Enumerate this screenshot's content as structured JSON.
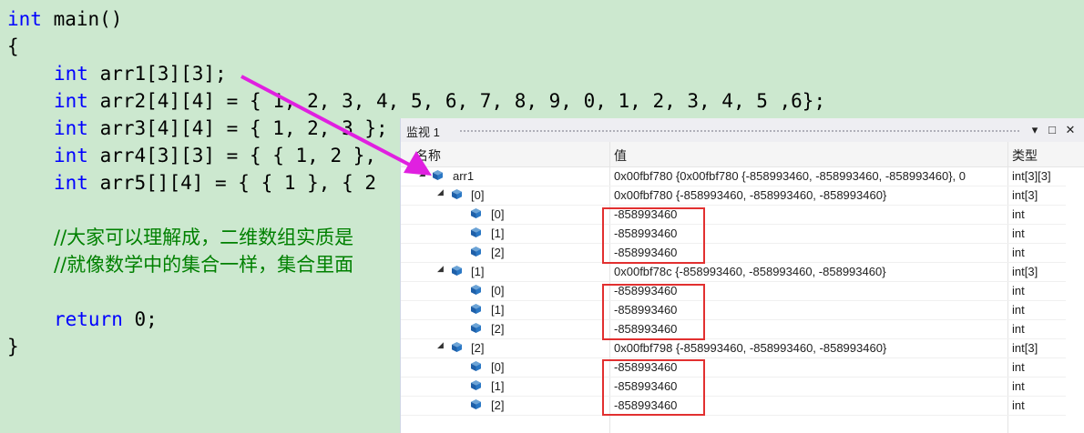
{
  "editor": {
    "lines": [
      {
        "kw": "int",
        "rest": " main()"
      },
      {
        "text": "{"
      },
      {
        "kw": "int",
        "rest": " arr1[3][3];",
        "indent": true
      },
      {
        "kw": "int",
        "rest": " arr2[4][4] = { 1, 2, 3, 4, 5, 6, 7, 8, 9, 0, 1, 2, 3, 4, 5 ,6};",
        "indent": true
      },
      {
        "kw": "int",
        "rest": " arr3[4][4] = { 1, 2, 3 };",
        "indent": true
      },
      {
        "kw": "int",
        "rest": " arr4[3][3] = { { 1, 2 },",
        "indent": true
      },
      {
        "kw": "int",
        "rest": " arr5[][4] = { { 1 }, { 2",
        "indent": true
      },
      {
        "comment": "//大家可以理解成，二维数组实质是",
        "indent": true
      },
      {
        "comment": "//就像数学中的集合一样，集合里面",
        "indent": true
      },
      {
        "kw": "return",
        "rest": " 0;",
        "indent": true
      },
      {
        "text": "}"
      }
    ]
  },
  "watch": {
    "title": "监视 1",
    "buttons": {
      "dropdown": "▾",
      "maximize": "□",
      "close": "✕"
    },
    "columns": {
      "name": "名称",
      "value": "值",
      "type": "类型"
    },
    "rows": [
      {
        "name": "arr1",
        "value": "0x00fbf780 {0x00fbf780 {-858993460, -858993460, -858993460}, 0",
        "type": "int[3][3]",
        "level": 0,
        "expander": "◢"
      },
      {
        "name": "[0]",
        "value": "0x00fbf780 {-858993460, -858993460, -858993460}",
        "type": "int[3]",
        "level": 1,
        "expander": "◢"
      },
      {
        "name": "[0]",
        "value": "-858993460",
        "type": "int",
        "level": 2
      },
      {
        "name": "[1]",
        "value": "-858993460",
        "type": "int",
        "level": 2
      },
      {
        "name": "[2]",
        "value": "-858993460",
        "type": "int",
        "level": 2
      },
      {
        "name": "[1]",
        "value": "0x00fbf78c {-858993460, -858993460, -858993460}",
        "type": "int[3]",
        "level": 1,
        "expander": "◢"
      },
      {
        "name": "[0]",
        "value": "-858993460",
        "type": "int",
        "level": 2
      },
      {
        "name": "[1]",
        "value": "-858993460",
        "type": "int",
        "level": 2
      },
      {
        "name": "[2]",
        "value": "-858993460",
        "type": "int",
        "level": 2
      },
      {
        "name": "[2]",
        "value": "0x00fbf798 {-858993460, -858993460, -858993460}",
        "type": "int[3]",
        "level": 1,
        "expander": "◢"
      },
      {
        "name": "[0]",
        "value": "-858993460",
        "type": "int",
        "level": 2
      },
      {
        "name": "[1]",
        "value": "-858993460",
        "type": "int",
        "level": 2
      },
      {
        "name": "[2]",
        "value": "-858993460",
        "type": "int",
        "level": 2
      }
    ]
  },
  "colors": {
    "arrow": "#e020e0",
    "highlight_box": "#e23030",
    "keyword": "#0000ff",
    "comment": "#008000",
    "editor_bg": "#cce8cf"
  }
}
